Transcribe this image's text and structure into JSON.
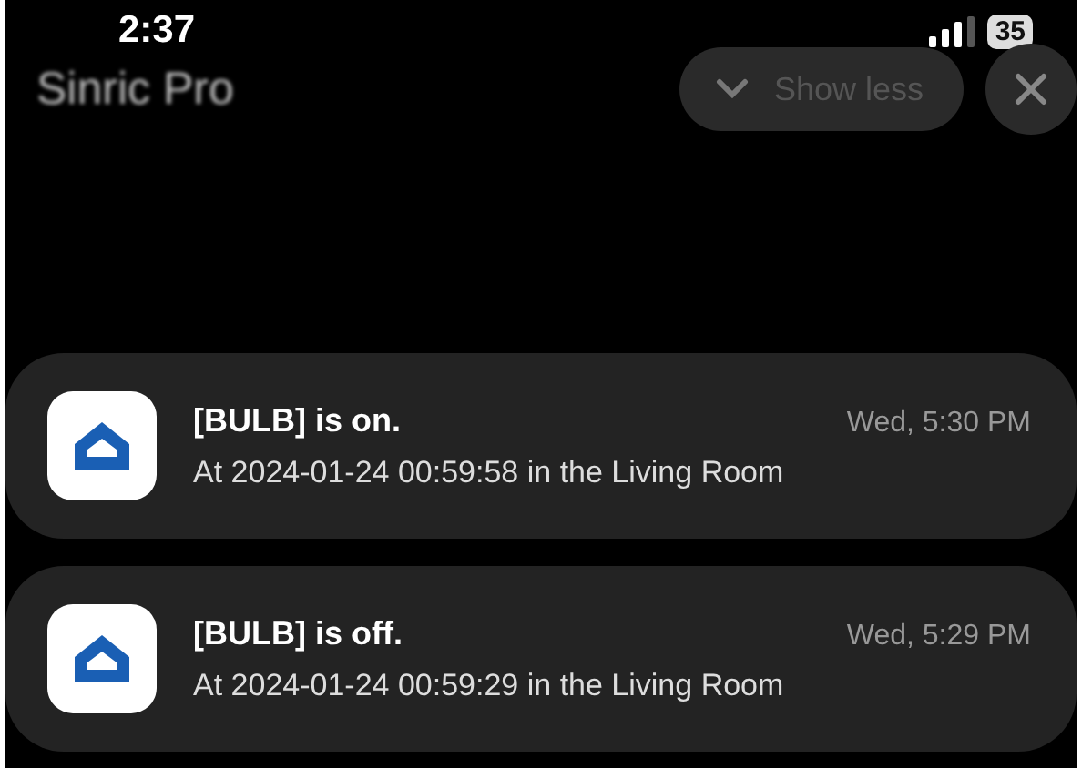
{
  "status_bar": {
    "time": "2:37",
    "battery": "35"
  },
  "header": {
    "app_name": "Sinric Pro",
    "show_less": "Show less"
  },
  "notifications": [
    {
      "title": "[BULB] is on.",
      "time": "Wed, 5:30 PM",
      "body": "At 2024-01-24 00:59:58 in the Living Room"
    },
    {
      "title": "[BULB] is off.",
      "time": "Wed, 5:29 PM",
      "body": "At 2024-01-24 00:59:29 in the Living Room"
    }
  ]
}
